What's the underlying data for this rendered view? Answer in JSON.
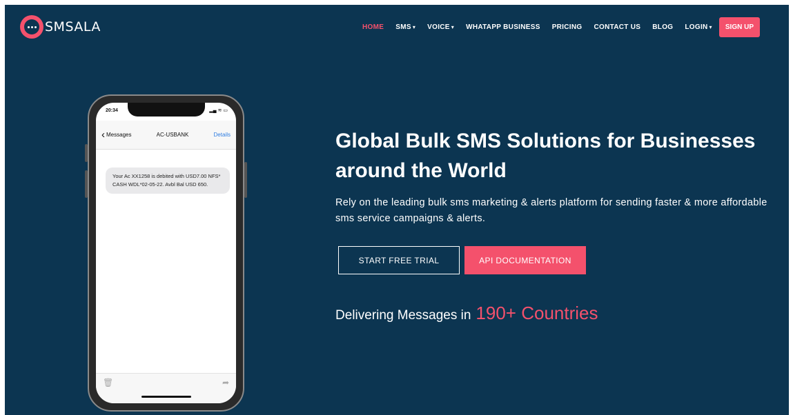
{
  "brand": {
    "name": "SMSALA",
    "accent_color": "#f4516c",
    "background_color": "#0c3551"
  },
  "nav": {
    "items": [
      {
        "label": "HOME",
        "active": true,
        "has_dropdown": false
      },
      {
        "label": "SMS",
        "active": false,
        "has_dropdown": true
      },
      {
        "label": "VOICE",
        "active": false,
        "has_dropdown": true
      },
      {
        "label": "WHATAPP BUSINESS",
        "active": false,
        "has_dropdown": false
      },
      {
        "label": "PRICING",
        "active": false,
        "has_dropdown": false
      },
      {
        "label": "CONTACT US",
        "active": false,
        "has_dropdown": false
      },
      {
        "label": "BLOG",
        "active": false,
        "has_dropdown": false
      },
      {
        "label": "LOGIN",
        "active": false,
        "has_dropdown": true
      }
    ],
    "signup_label": "SIGN UP"
  },
  "phone": {
    "status_time": "20:34",
    "back_label": "Messages",
    "contact": "AC-USBANK",
    "details_label": "Details",
    "message": "Your Ac XX1258 is debited with USD7.00 NFS* CASH WDL*02-05-22. Avbl Bal USD 650."
  },
  "hero": {
    "title": "Global Bulk SMS Solutions for Businesses around the World",
    "subtitle": "Rely on the leading bulk sms marketing & alerts platform for sending faster & more affordable sms service campaigns & alerts.",
    "primary_button": "START FREE TRIAL",
    "secondary_button": "API DOCUMENTATION",
    "delivering_prefix": "Delivering Messages in",
    "delivering_highlight": "190+ Countries"
  }
}
